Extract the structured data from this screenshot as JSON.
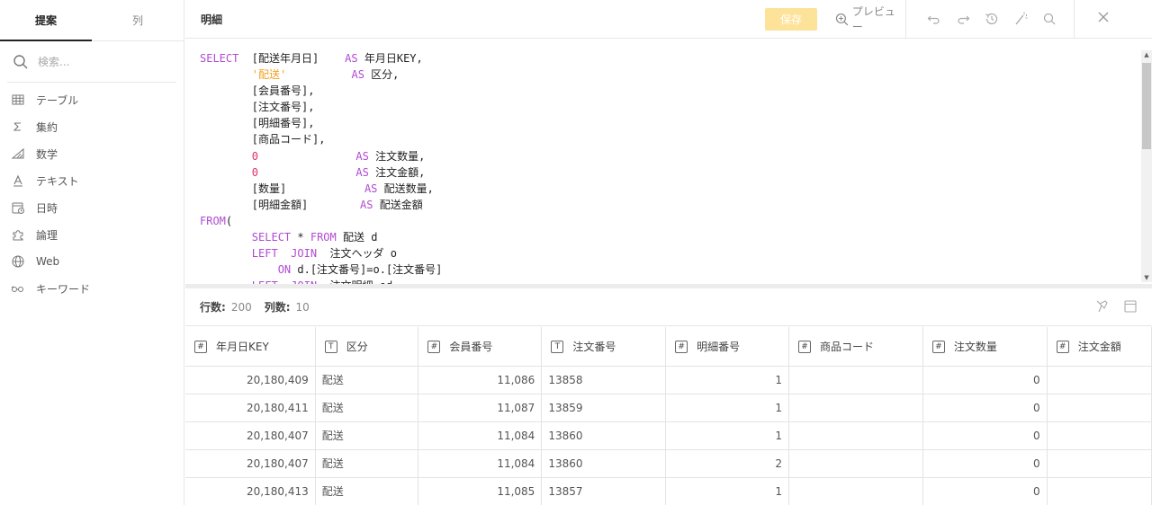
{
  "sidebar": {
    "tabs": [
      {
        "label": "提案"
      },
      {
        "label": "列"
      }
    ],
    "search_placeholder": "検索...",
    "items": [
      {
        "label": "テーブル",
        "icon": "table-icon"
      },
      {
        "label": "集約",
        "icon": "sigma-icon"
      },
      {
        "label": "数学",
        "icon": "math-icon"
      },
      {
        "label": "テキスト",
        "icon": "text-icon"
      },
      {
        "label": "日時",
        "icon": "calendar-icon"
      },
      {
        "label": "論理",
        "icon": "puzzle-icon"
      },
      {
        "label": "Web",
        "icon": "globe-icon"
      },
      {
        "label": "キーワード",
        "icon": "keyword-icon"
      }
    ]
  },
  "header": {
    "title": "明細",
    "save_label": "保存",
    "preview_label": "プレビュー"
  },
  "editor": {
    "lines": [
      [
        [
          "kw",
          "SELECT"
        ],
        [
          "t",
          "  [配送年月日]    "
        ],
        [
          "kw",
          "AS"
        ],
        [
          "t",
          " 年月日KEY,"
        ]
      ],
      [
        [
          "t",
          "        "
        ],
        [
          "str",
          "'配送'"
        ],
        [
          "t",
          "          "
        ],
        [
          "kw",
          "AS"
        ],
        [
          "t",
          " 区分,"
        ]
      ],
      [
        [
          "t",
          "        [会員番号],"
        ]
      ],
      [
        [
          "t",
          "        [注文番号],"
        ]
      ],
      [
        [
          "t",
          "        [明細番号],"
        ]
      ],
      [
        [
          "t",
          "        [商品コード],"
        ]
      ],
      [
        [
          "t",
          "        "
        ],
        [
          "num",
          "0"
        ],
        [
          "t",
          "               "
        ],
        [
          "kw",
          "AS"
        ],
        [
          "t",
          " 注文数量,"
        ]
      ],
      [
        [
          "t",
          "        "
        ],
        [
          "num",
          "0"
        ],
        [
          "t",
          "               "
        ],
        [
          "kw",
          "AS"
        ],
        [
          "t",
          " 注文金額,"
        ]
      ],
      [
        [
          "t",
          "        [数量]            "
        ],
        [
          "kw",
          "AS"
        ],
        [
          "t",
          " 配送数量,"
        ]
      ],
      [
        [
          "t",
          "        [明細金額]        "
        ],
        [
          "kw",
          "AS"
        ],
        [
          "t",
          " 配送金額"
        ]
      ],
      [
        [
          "kw",
          "FROM"
        ],
        [
          "t",
          "("
        ]
      ],
      [
        [
          "t",
          "        "
        ],
        [
          "kw",
          "SELECT"
        ],
        [
          "t",
          " * "
        ],
        [
          "kw",
          "FROM"
        ],
        [
          "t",
          " 配送 d"
        ]
      ],
      [
        [
          "t",
          "        "
        ],
        [
          "kw",
          "LEFT"
        ],
        [
          "t",
          "  "
        ],
        [
          "kw",
          "JOIN"
        ],
        [
          "t",
          "  注文ヘッダ o"
        ]
      ],
      [
        [
          "t",
          "            "
        ],
        [
          "kw",
          "ON"
        ],
        [
          "t",
          " d.[注文番号]=o.[注文番号]"
        ]
      ],
      [
        [
          "t",
          "        "
        ],
        [
          "kw",
          "LEFT"
        ],
        [
          "t",
          "  "
        ],
        [
          "kw",
          "JOIN"
        ],
        [
          "t",
          "  注文明細 od"
        ]
      ]
    ]
  },
  "results": {
    "rows_label": "行数:",
    "rows_value": "200",
    "cols_label": "列数:",
    "cols_value": "10",
    "columns": [
      {
        "name": "年月日KEY",
        "type": "#"
      },
      {
        "name": "区分",
        "type": "T"
      },
      {
        "name": "会員番号",
        "type": "#"
      },
      {
        "name": "注文番号",
        "type": "T"
      },
      {
        "name": "明細番号",
        "type": "#"
      },
      {
        "name": "商品コード",
        "type": "#"
      },
      {
        "name": "注文数量",
        "type": "#"
      },
      {
        "name": "注文金額",
        "type": "#"
      }
    ],
    "rows": [
      [
        "20,180,409",
        "配送",
        "11,086",
        "13858",
        "1",
        "",
        "0",
        ""
      ],
      [
        "20,180,411",
        "配送",
        "11,087",
        "13859",
        "1",
        "",
        "0",
        ""
      ],
      [
        "20,180,407",
        "配送",
        "11,084",
        "13860",
        "1",
        "",
        "0",
        ""
      ],
      [
        "20,180,407",
        "配送",
        "11,084",
        "13860",
        "2",
        "",
        "0",
        ""
      ],
      [
        "20,180,413",
        "配送",
        "11,085",
        "13857",
        "1",
        "",
        "0",
        ""
      ]
    ]
  }
}
